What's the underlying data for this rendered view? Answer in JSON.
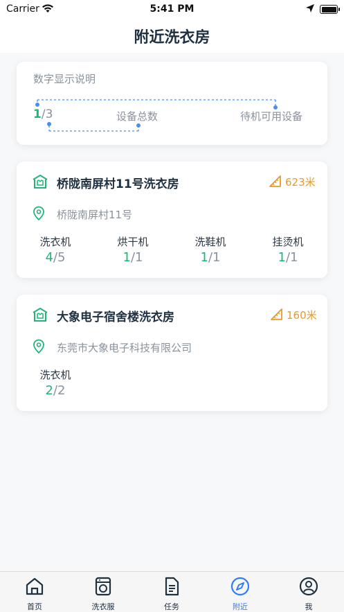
{
  "status_bar": {
    "carrier": "Carrier",
    "time": "5:41 PM"
  },
  "page_title": "附近洗衣房",
  "legend": {
    "title": "数字显示说明",
    "available": "1",
    "slash_total": "/3",
    "total_label": "设备总数",
    "available_label": "待机可用设备"
  },
  "shops": [
    {
      "name": "桥陇南屏村11号洗衣房",
      "distance": "623米",
      "address": "桥陇南屏村11号",
      "machines": [
        {
          "name": "洗衣机",
          "available": "4",
          "total": "/5"
        },
        {
          "name": "烘干机",
          "available": "1",
          "total": "/1"
        },
        {
          "name": "洗鞋机",
          "available": "1",
          "total": "/1"
        },
        {
          "name": "挂烫机",
          "available": "1",
          "total": "/1"
        }
      ]
    },
    {
      "name": "大象电子宿舍楼洗衣房",
      "distance": "160米",
      "address": "东莞市大象电子科技有限公司",
      "machines": [
        {
          "name": "洗衣机",
          "available": "2",
          "total": "/2"
        }
      ]
    }
  ],
  "tabbar": {
    "items": [
      {
        "label": "首页",
        "icon": "home-icon"
      },
      {
        "label": "洗衣服",
        "icon": "washer-icon"
      },
      {
        "label": "任务",
        "icon": "document-icon"
      },
      {
        "label": "附近",
        "icon": "compass-icon"
      },
      {
        "label": "我",
        "icon": "user-icon"
      }
    ],
    "active_index": 3
  },
  "colors": {
    "accent_green": "#1fb57a",
    "accent_orange": "#e59a2a",
    "accent_blue": "#2e7cf6",
    "text_dark": "#1f3041",
    "text_gray": "#8a929c"
  }
}
